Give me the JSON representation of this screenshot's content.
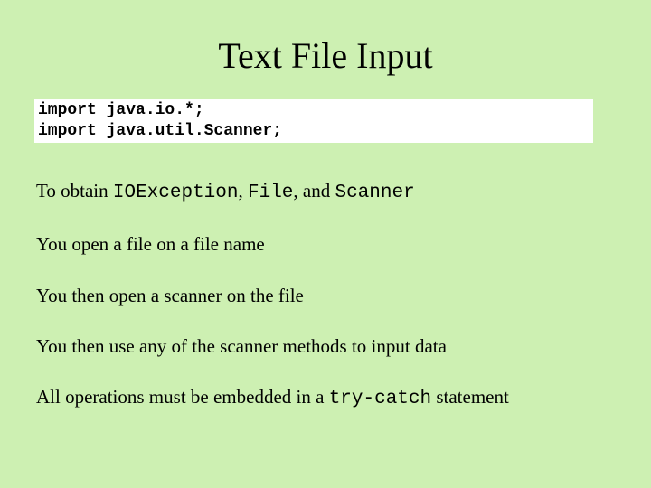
{
  "title": "Text File Input",
  "code": {
    "line1": "import java.io.*;",
    "line2": "import java.util.Scanner;"
  },
  "body": {
    "p1_a": "To obtain ",
    "p1_cls1": "IOException",
    "p1_b": ", ",
    "p1_cls2": "File",
    "p1_c": ", and ",
    "p1_cls3": "Scanner",
    "p2": "You open a file on a file name",
    "p3": "You then open a scanner on the file",
    "p4": "You then use any of the scanner methods to input data",
    "p5_a": "All operations must be embedded in a ",
    "p5_code": "try-catch",
    "p5_b": " statement"
  }
}
